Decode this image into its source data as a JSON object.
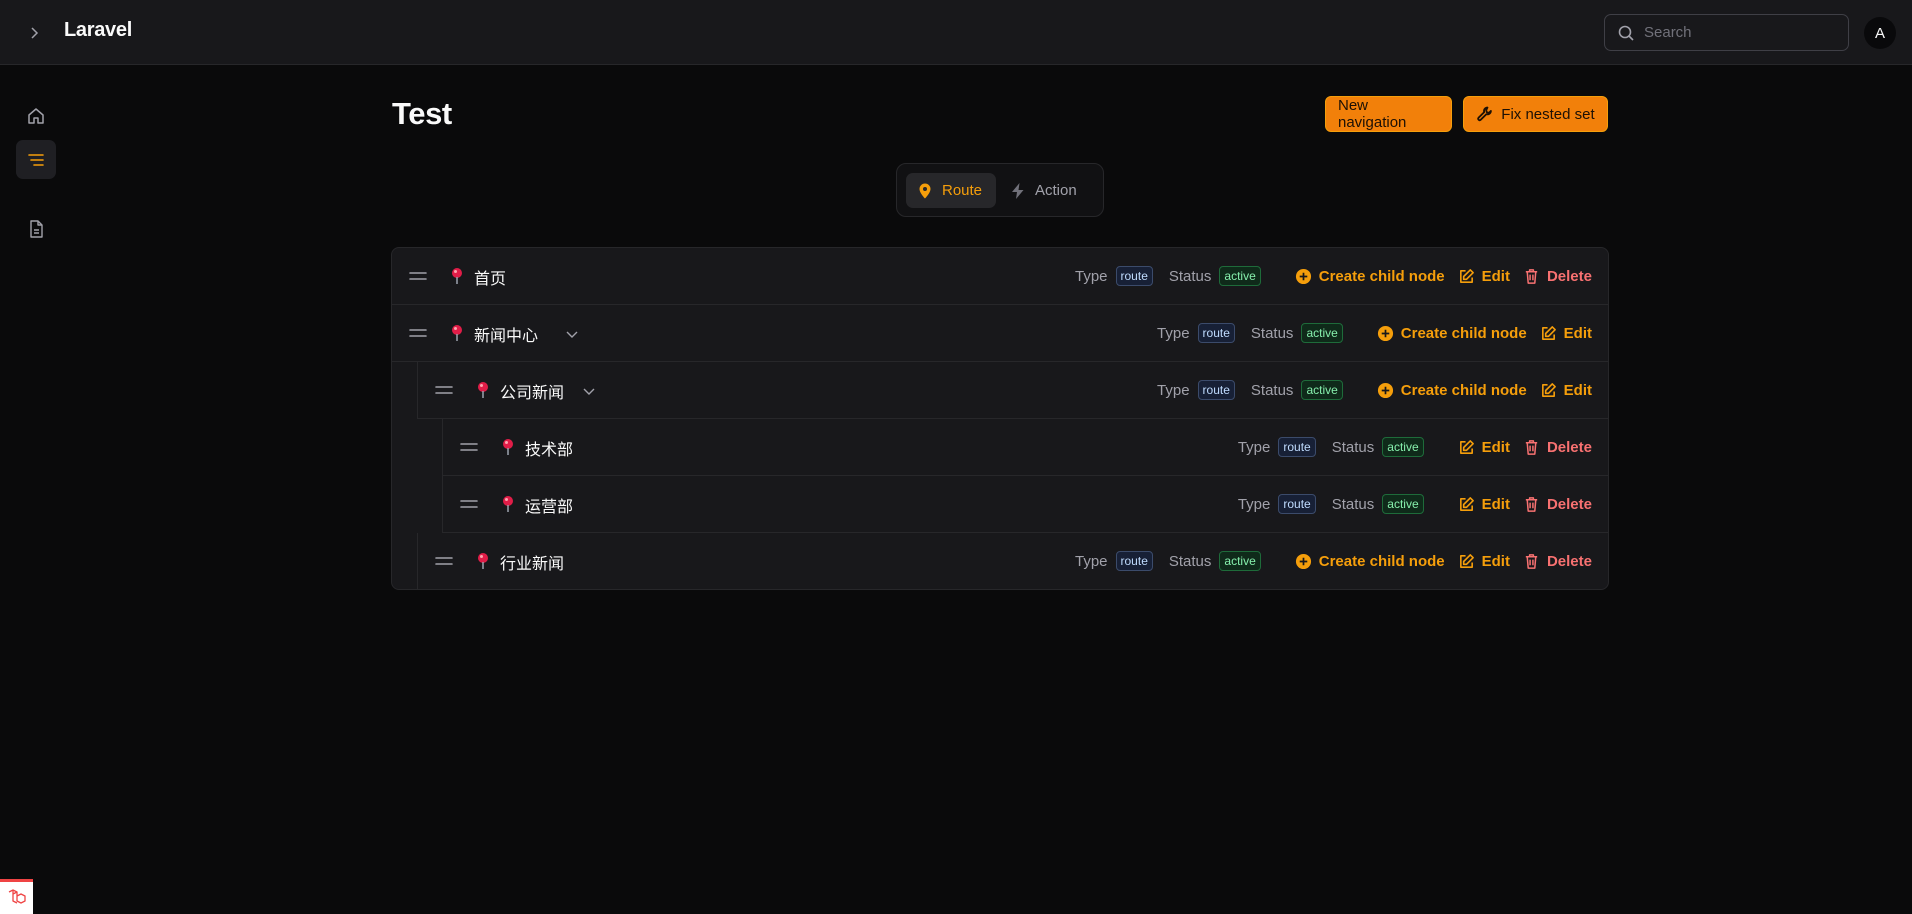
{
  "app": {
    "brand": "Laravel",
    "avatar_initial": "A"
  },
  "search": {
    "placeholder": "Search",
    "value": ""
  },
  "sidebar": {
    "items": [
      {
        "name": "home",
        "icon": "home-icon",
        "active": false
      },
      {
        "name": "navigation",
        "icon": "menu-lines-icon",
        "active": true
      },
      {
        "name": "documents",
        "icon": "document-icon",
        "active": false
      }
    ]
  },
  "page": {
    "title": "Test",
    "new_navigation_label": "New navigation",
    "fix_nested_set_label": "Fix nested set"
  },
  "tabs": [
    {
      "label": "Route",
      "icon": "map-pin-icon",
      "active": true
    },
    {
      "label": "Action",
      "icon": "bolt-icon",
      "active": false
    }
  ],
  "labels": {
    "type": "Type",
    "status": "Status",
    "create_child": "Create child node",
    "edit": "Edit",
    "delete": "Delete"
  },
  "tree": [
    {
      "label": "首页",
      "depth": 0,
      "type": "route",
      "status": "active",
      "expandable": false,
      "actions": [
        "create",
        "edit",
        "delete"
      ]
    },
    {
      "label": "新闻中心",
      "depth": 0,
      "type": "route",
      "status": "active",
      "expandable": true,
      "actions": [
        "create",
        "edit"
      ]
    },
    {
      "label": "公司新闻",
      "depth": 1,
      "type": "route",
      "status": "active",
      "expandable": true,
      "actions": [
        "create",
        "edit"
      ]
    },
    {
      "label": "技术部",
      "depth": 2,
      "type": "route",
      "status": "active",
      "expandable": false,
      "actions": [
        "edit",
        "delete"
      ]
    },
    {
      "label": "运营部",
      "depth": 2,
      "type": "route",
      "status": "active",
      "expandable": false,
      "actions": [
        "edit",
        "delete"
      ]
    },
    {
      "label": "行业新闻",
      "depth": 1,
      "type": "route",
      "status": "active",
      "expandable": false,
      "actions": [
        "create",
        "edit",
        "delete"
      ]
    }
  ],
  "colors": {
    "accent": "#f59e0b",
    "danger": "#f87171",
    "pin": "#e11d48"
  }
}
